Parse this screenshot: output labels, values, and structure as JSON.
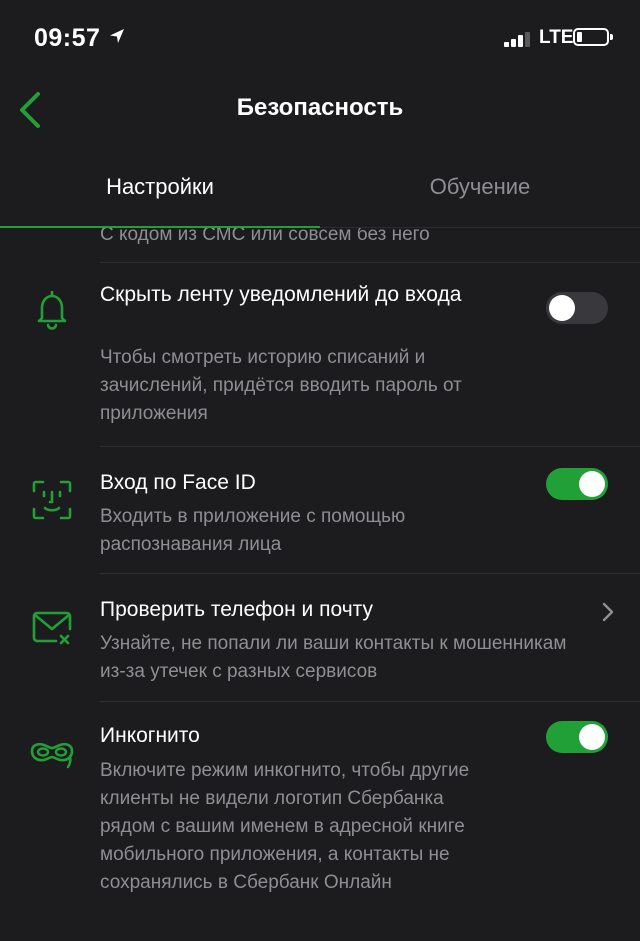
{
  "status_bar": {
    "time": "09:57",
    "network": "LTE"
  },
  "header": {
    "title": "Безопасность"
  },
  "tabs": [
    {
      "label": "Настройки",
      "active": true
    },
    {
      "label": "Обучение",
      "active": false
    }
  ],
  "partial_row_text": "С кодом из СМС или совсем без него",
  "settings": [
    {
      "icon": "bell-icon",
      "label": "Скрыть ленту уведомлений до входа",
      "description": "Чтобы смотреть историю списаний и зачислений, придётся вводить пароль от приложения",
      "control": "toggle",
      "enabled": false
    },
    {
      "icon": "face-id-icon",
      "label": "Вход по Face ID",
      "description": "Входить в приложение с помощью распознавания лица",
      "control": "toggle",
      "enabled": true
    },
    {
      "icon": "envelope-icon",
      "label": "Проверить телефон и почту",
      "description": "Узнайте, не попали ли ваши контакты к мошенникам из-за утечек с разных сервисов",
      "control": "chevron-right-icon"
    },
    {
      "icon": "mask-icon",
      "label": "Инкогнито",
      "description": "Включите режим инкогнито, чтобы другие клиенты не видели логотип Сбербанка рядом с вашим именем в адресной книге мобильного приложения, а контакты не сохранялись в Сбербанк Онлайн",
      "control": "toggle",
      "enabled": true
    }
  ],
  "colors": {
    "accent": "#21a038",
    "background": "#1c1c1e",
    "secondary_text": "#8e8e93"
  }
}
